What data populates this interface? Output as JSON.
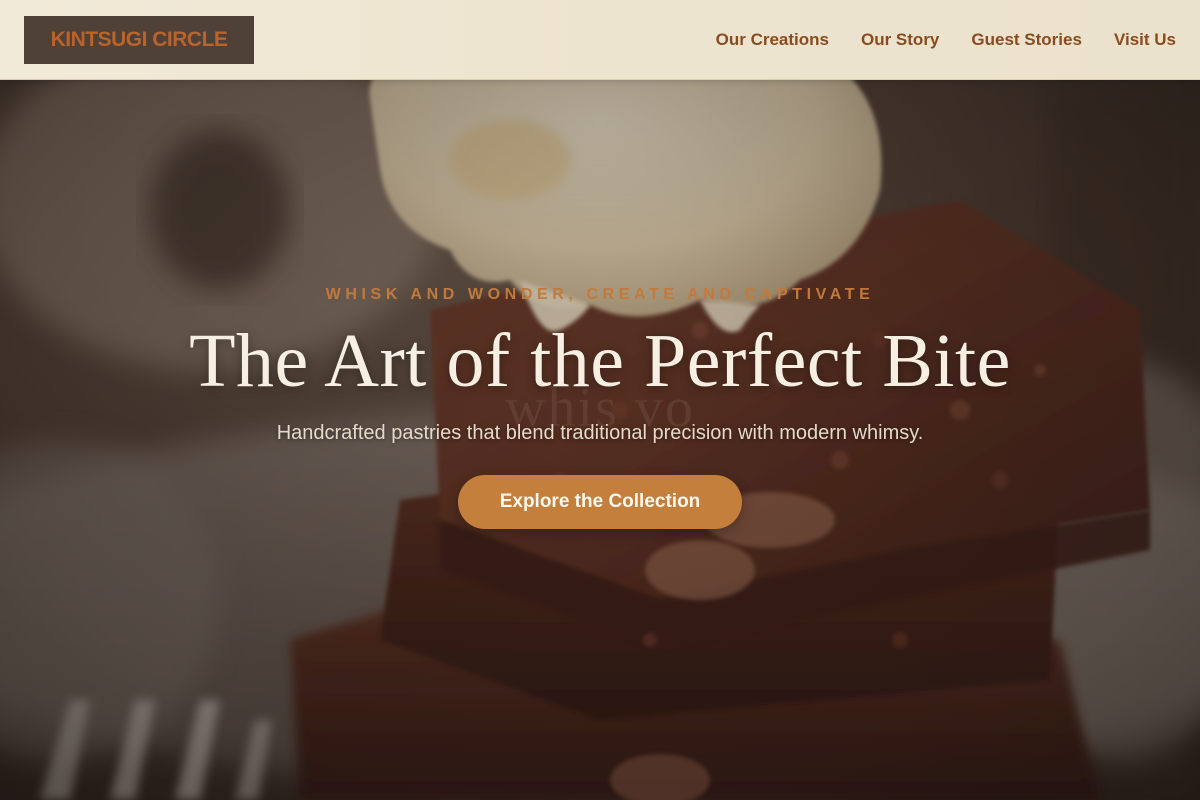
{
  "header": {
    "logo_text": "KINTSUGI CIRCLE",
    "nav": [
      {
        "label": "Our Creations"
      },
      {
        "label": "Our Story"
      },
      {
        "label": "Guest Stories"
      },
      {
        "label": "Visit Us"
      }
    ]
  },
  "hero": {
    "eyebrow": "WHISK AND WONDER, CREATE AND CAPTIVATE",
    "headline": "The Art of the Perfect Bite",
    "ghost_text": "whis      vo",
    "subheadline": "Handcrafted pastries that blend traditional precision with modern whimsy.",
    "cta_label": "Explore the Collection",
    "background_image": "chocolate-brownie-ice-cream-photo"
  },
  "colors": {
    "header_bg": "#ede4cf",
    "logo_bg": "#4f4038",
    "logo_text": "#b8642a",
    "nav_text": "#8a4b1f",
    "accent": "#c47f3c",
    "headline": "#f7efe2"
  }
}
